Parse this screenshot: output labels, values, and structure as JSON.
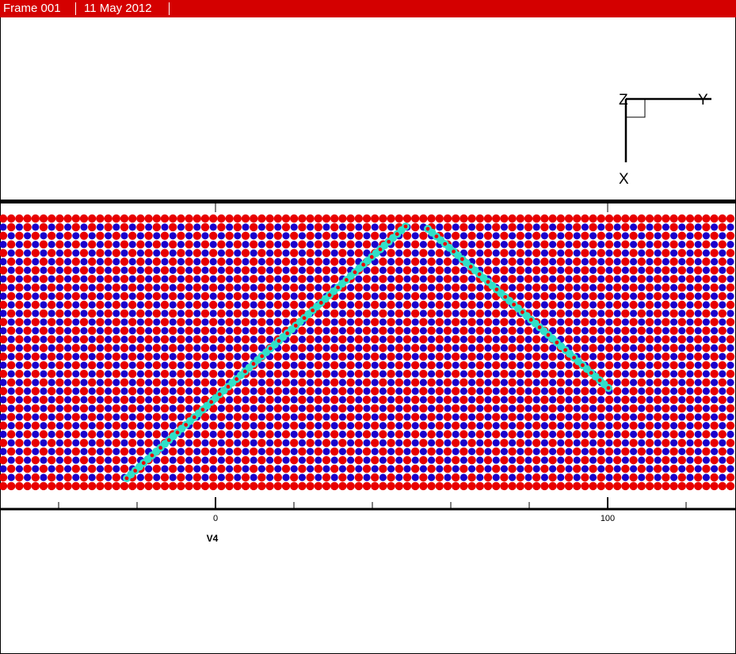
{
  "header": {
    "frame_label": "Frame 001",
    "date": "11 May 2012"
  },
  "triad": {
    "z_label": "Z",
    "y_label": "Y",
    "x_label": "X"
  },
  "axis": {
    "variable_label": "V4",
    "tick_labels": [
      "0",
      "100"
    ]
  },
  "colors": {
    "header_background": "#d40000",
    "atom_red": "#e80000",
    "atom_blue": "#1a00cc",
    "dislocation_cyan": "#30e0c8",
    "background": "#ffffff"
  }
}
